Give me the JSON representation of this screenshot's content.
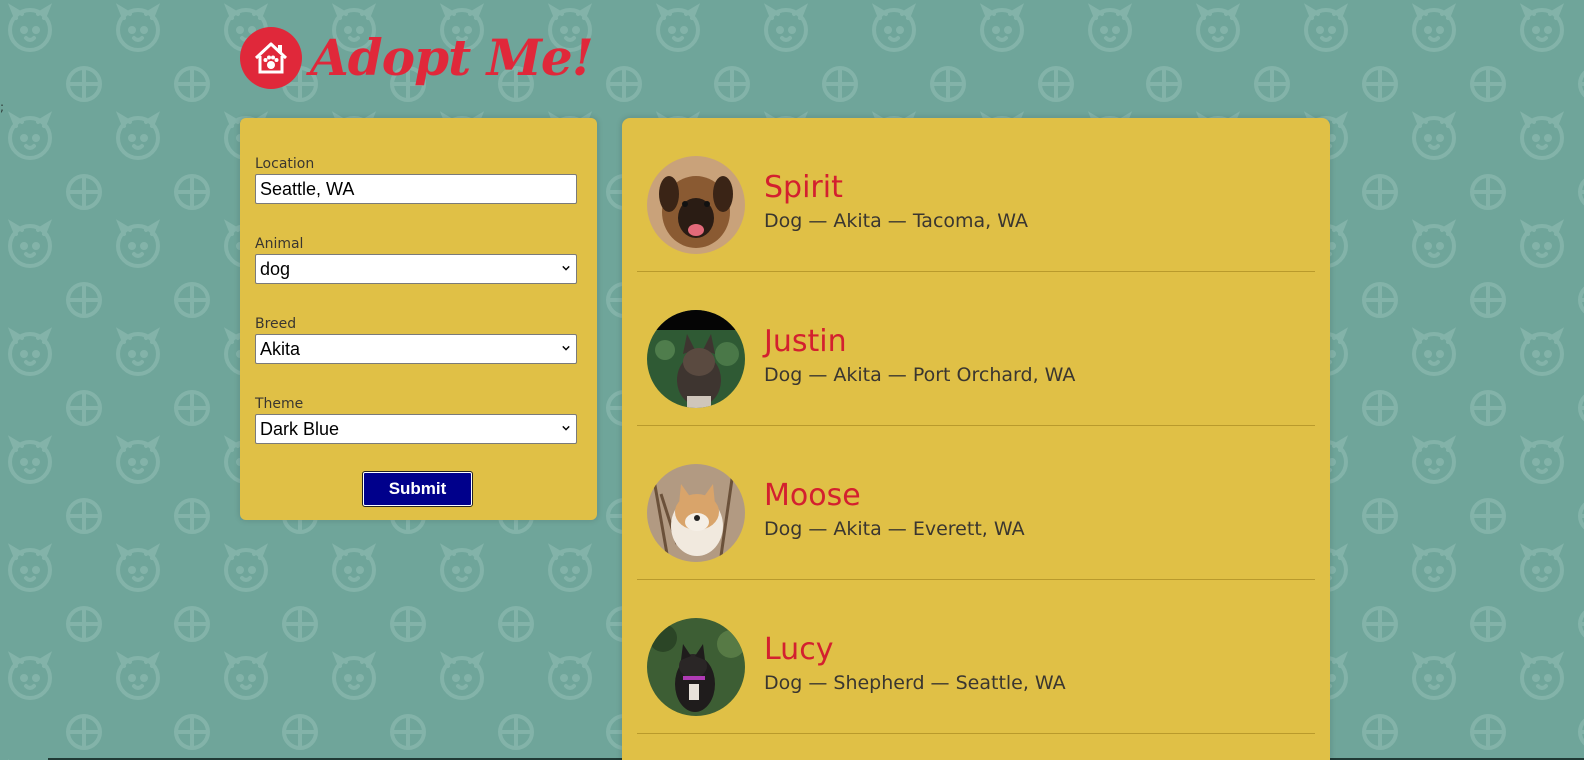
{
  "app": {
    "title": "Adopt Me!"
  },
  "stray_text": ";",
  "search": {
    "location": {
      "label": "Location",
      "value": "Seattle, WA"
    },
    "animal": {
      "label": "Animal",
      "value": "dog"
    },
    "breed": {
      "label": "Breed",
      "value": "Akita"
    },
    "theme": {
      "label": "Theme",
      "value": "Dark Blue"
    },
    "submit_label": "Submit"
  },
  "pets": [
    {
      "name": "Spirit",
      "desc": "Dog — Akita — Tacoma, WA"
    },
    {
      "name": "Justin",
      "desc": "Dog — Akita — Port Orchard, WA"
    },
    {
      "name": "Moose",
      "desc": "Dog — Akita — Everett, WA"
    },
    {
      "name": "Lucy",
      "desc": "Dog — Shepherd — Seattle, WA"
    }
  ],
  "colors": {
    "background": "#6fa59a",
    "panel": "#e0c046",
    "accent": "#e0283a",
    "pet_name": "#d3202f",
    "button": "#00008b"
  },
  "icons": [
    "paw-house-logo-icon",
    "chevron-down-icon"
  ]
}
